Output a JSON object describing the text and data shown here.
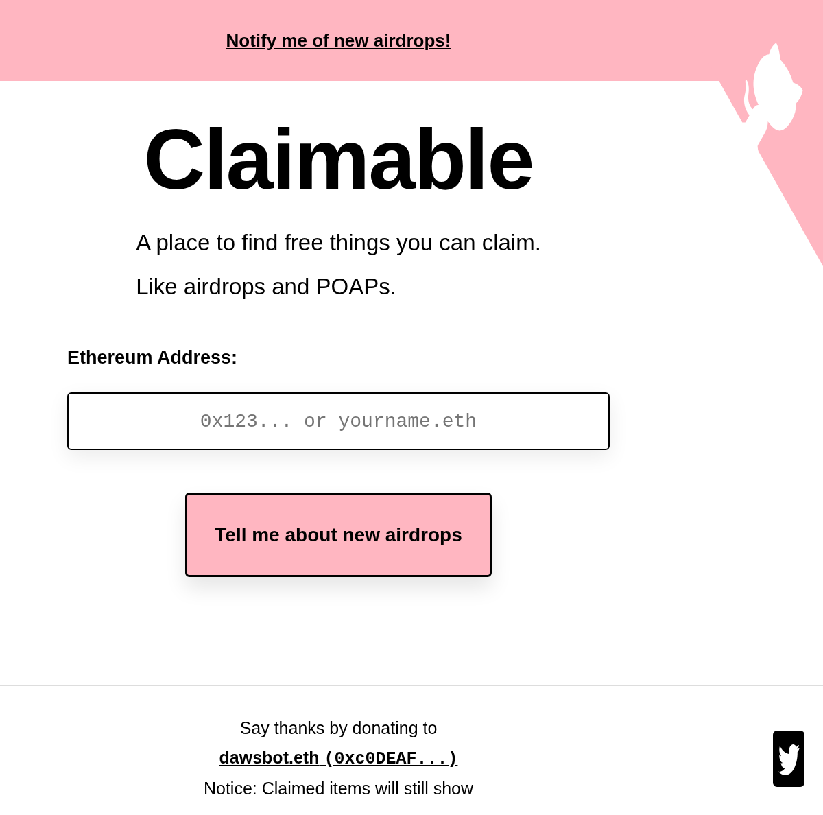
{
  "banner": {
    "link": "Notify me of new airdrops!"
  },
  "title": "Claimable",
  "tagline": [
    "A place to find free things you can claim.",
    "Like airdrops and POAPs."
  ],
  "address_field": {
    "label": "Ethereum Address:",
    "placeholder": "0x123... or yourname.eth"
  },
  "submit_button": {
    "label": "Tell me about new airdrops"
  },
  "footer": {
    "thanks": "Say thanks by donating to",
    "donation_link": {
      "name": "dawsbot.eth",
      "address": "(0xc0DEAF...)"
    },
    "notice": "Notice: Claimed items will still show"
  }
}
